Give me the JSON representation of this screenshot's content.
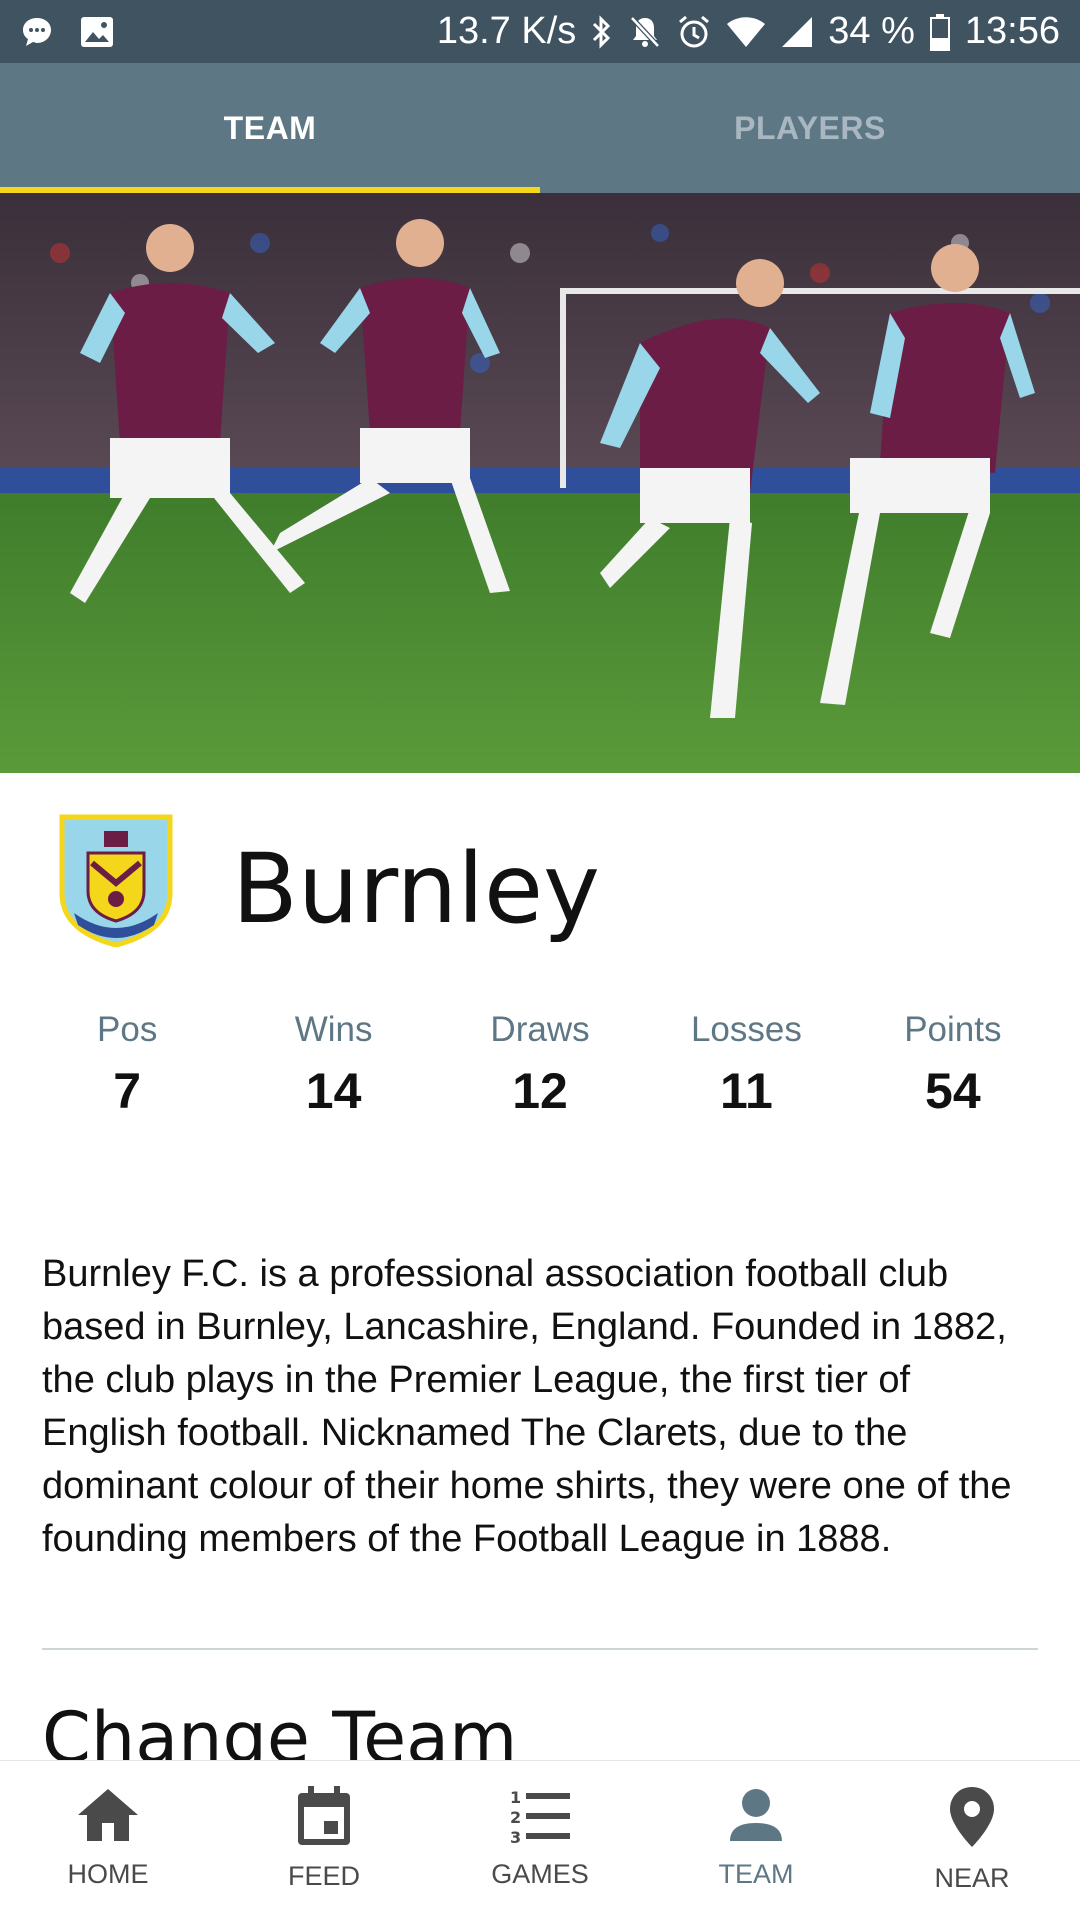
{
  "status_bar": {
    "net_speed": "13.7 K/s",
    "battery": "34 %",
    "time": "13:56"
  },
  "tabs": [
    {
      "label": "TEAM",
      "active": true
    },
    {
      "label": "PLAYERS",
      "active": false
    }
  ],
  "team": {
    "name": "Burnley",
    "stats": [
      {
        "label": "Pos",
        "value": "7"
      },
      {
        "label": "Wins",
        "value": "14"
      },
      {
        "label": "Draws",
        "value": "12"
      },
      {
        "label": "Losses",
        "value": "11"
      },
      {
        "label": "Points",
        "value": "54"
      }
    ],
    "description": "Burnley F.C. is a professional association football club based in Burnley, Lancashire, England. Founded in 1882, the club plays in the Premier League, the first tier of English football. Nicknamed The Clarets, due to the dominant colour of their home shirts, they were one of the founding members of the Football League in 1888."
  },
  "change_team": {
    "title": "Change Team"
  },
  "bottom_nav": [
    {
      "label": "HOME",
      "icon": "home-icon"
    },
    {
      "label": "FEED",
      "icon": "calendar-icon"
    },
    {
      "label": "GAMES",
      "icon": "numbered-list-icon"
    },
    {
      "label": "TEAM",
      "icon": "person-icon",
      "active": true
    },
    {
      "label": "NEAR",
      "icon": "location-pin-icon"
    }
  ],
  "colors": {
    "primary": "#5e7785",
    "status_bar": "#3f5360",
    "accent": "#f4d61a",
    "claret": "#6c1d45",
    "sky_blue": "#99d6ea"
  }
}
